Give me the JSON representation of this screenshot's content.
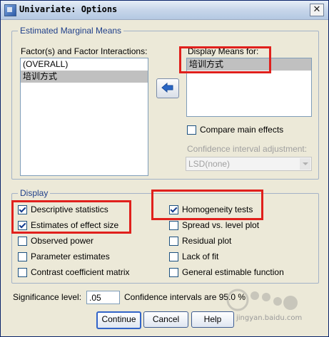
{
  "window": {
    "title": "Univariate: Options",
    "close_glyph": "✕"
  },
  "emm": {
    "group_label": "Estimated Marginal Means",
    "factors_label": "Factor(s) and Factor Interactions:",
    "factors": [
      "(OVERALL)",
      "培训方式"
    ],
    "display_means_label": "Display Means for:",
    "display_means": [
      "培训方式"
    ],
    "compare_main_effects": {
      "label": "Compare main effects",
      "checked": false
    },
    "ci_adjustment_label": "Confidence interval adjustment:",
    "ci_adjustment_value": "LSD(none)"
  },
  "display": {
    "group_label": "Display",
    "left": [
      {
        "label": "Descriptive statistics",
        "checked": true
      },
      {
        "label": "Estimates of effect size",
        "checked": true
      },
      {
        "label": "Observed power",
        "checked": false
      },
      {
        "label": "Parameter estimates",
        "checked": false
      },
      {
        "label": "Contrast coefficient matrix",
        "checked": false
      }
    ],
    "right": [
      {
        "label": "Homogeneity tests",
        "checked": true
      },
      {
        "label": "Spread vs. level plot",
        "checked": false
      },
      {
        "label": "Residual plot",
        "checked": false
      },
      {
        "label": "Lack of fit",
        "checked": false
      },
      {
        "label": "General estimable function",
        "checked": false
      }
    ]
  },
  "significance": {
    "label": "Significance level:",
    "value": ".05",
    "ci_text": "Confidence intervals are 95.0 %"
  },
  "buttons": {
    "continue": "Continue",
    "cancel": "Cancel",
    "help": "Help"
  },
  "watermark": {
    "text": "jingyan.baidu.com"
  },
  "colors": {
    "highlight": "#e0201c",
    "group_label": "#1f3f8a",
    "selection": "#c0c0c0"
  }
}
